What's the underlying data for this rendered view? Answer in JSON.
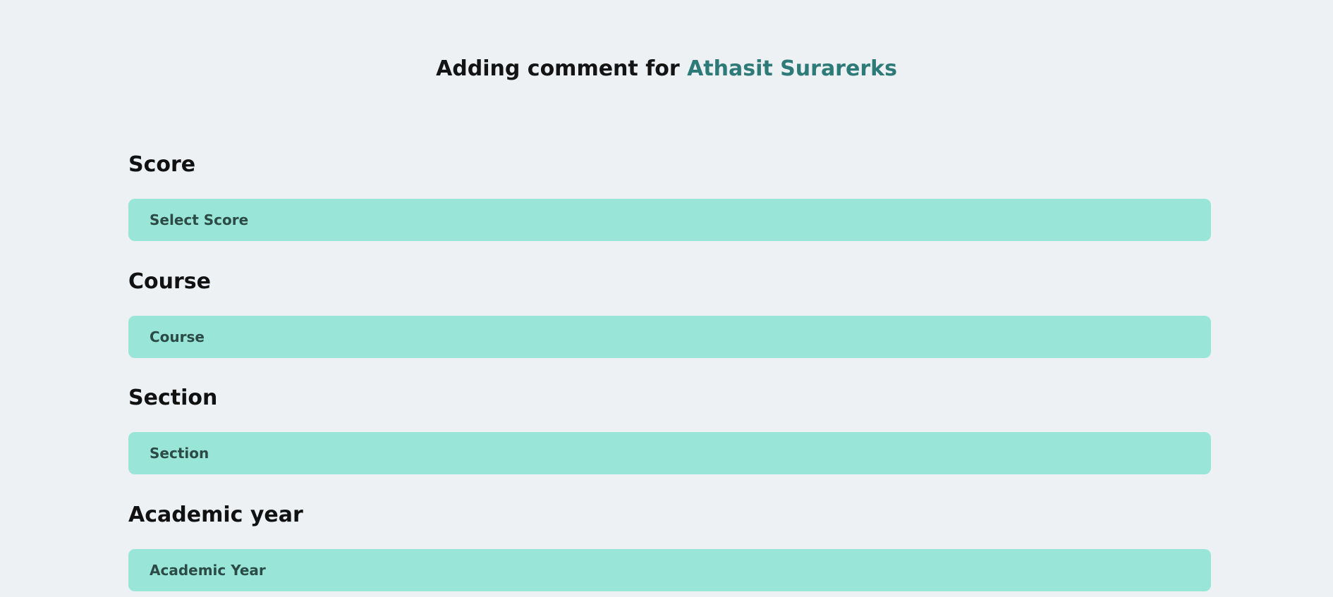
{
  "header": {
    "title_prefix": "Adding comment for ",
    "student_name": "Athasit Surarerks"
  },
  "fields": [
    {
      "label": "Score",
      "placeholder": "Select Score"
    },
    {
      "label": "Course",
      "placeholder": "Course"
    },
    {
      "label": "Section",
      "placeholder": "Section"
    },
    {
      "label": "Academic year",
      "placeholder": "Academic Year"
    }
  ],
  "colors": {
    "background": "#edf1f4",
    "accent": "#2d7a78",
    "field_fill": "#99e6d8"
  }
}
